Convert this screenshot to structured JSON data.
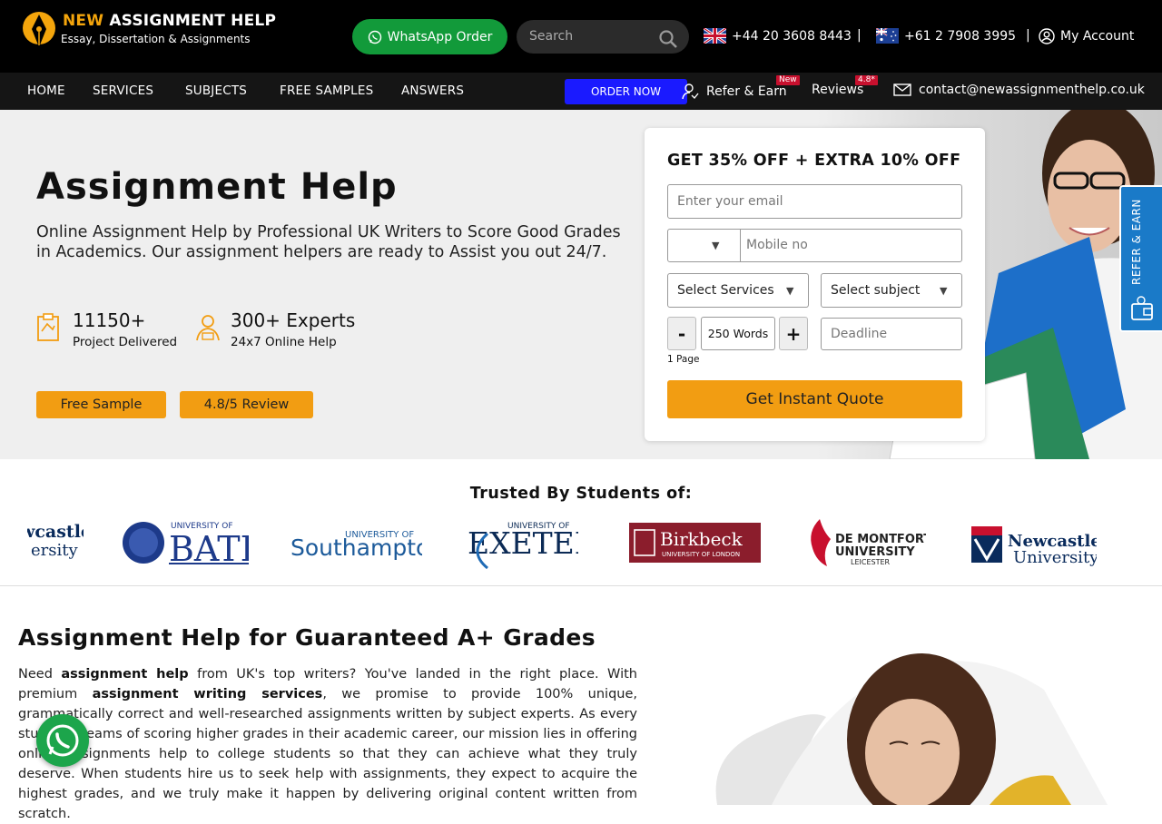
{
  "brand": {
    "name_part1": "NEW",
    "name_part2": "ASSIGNMENT HELP",
    "tagline": "Essay, Dissertation & Assignments"
  },
  "header": {
    "whatsapp_label": "WhatsApp Order",
    "search_placeholder": "Search",
    "phone_uk": "+44 20 3608 8443",
    "phone_au": "+61 2 7908 3995",
    "separator": "|",
    "account_label": "My Account"
  },
  "nav": {
    "items": [
      "HOME",
      "SERVICES",
      "SUBJECTS",
      "FREE SAMPLES",
      "ANSWERS"
    ],
    "order_label": "ORDER NOW",
    "refer_label": "Refer & Earn",
    "refer_badge": "New",
    "reviews_label": "Reviews",
    "reviews_badge": "4.8*",
    "contact_email": "contact@newassignmenthelp.co.uk"
  },
  "hero": {
    "title": "Assignment Help",
    "lead": "Online Assignment Help by Professional UK Writers to Score Good Grades in Academics. Our assignment helpers are ready to Assist you out 24/7.",
    "stats": [
      {
        "value": "11150+",
        "label": "Project Delivered"
      },
      {
        "value": "300+ Experts",
        "label": "24x7 Online Help"
      }
    ],
    "free_sample_label": "Free Sample",
    "review_label": "4.8/5 Review"
  },
  "quote_form": {
    "heading": "GET 35% OFF + EXTRA 10% OFF",
    "email_placeholder": "Enter your email",
    "mobile_placeholder": "Mobile no",
    "services_label": "Select Services",
    "subject_label": "Select subject",
    "minus": "-",
    "plus": "+",
    "words": "250 Words",
    "pages": "1 Page",
    "deadline_placeholder": "Deadline",
    "submit_label": "Get Instant Quote"
  },
  "refer_tab_label": "REFER & EARN",
  "trusted": {
    "heading": "Trusted By Students of:",
    "universities": [
      "Newcastle University",
      "University of Bath",
      "University of Southampton",
      "University of Exeter",
      "Birkbeck University of London",
      "De Montfort University Leicester",
      "Newcastle University"
    ]
  },
  "content": {
    "heading": "Assignment Help for Guaranteed A+ Grades",
    "p_pre": "Need ",
    "p_b1": "assignment help",
    "p_mid": " from UK's top writers? You've landed in the right place. With premium ",
    "p_b2": "assignment writing services",
    "p_post": ", we promise to provide 100% unique, grammatically correct and well-researched assignments written by subject experts. As every student dreams of scoring higher grades in their academic career, our mission lies in offering online assignments help to college students so that they can achieve what they truly deserve. When students hire us to seek help with assignments, they expect to acquire the highest grades, and we truly make it happen by delivering original content written from scratch."
  },
  "colors": {
    "accent": "#f29d12",
    "whatsapp": "#129a3a",
    "order_blue": "#1a1aff",
    "refer_blue": "#1a7ac8"
  }
}
